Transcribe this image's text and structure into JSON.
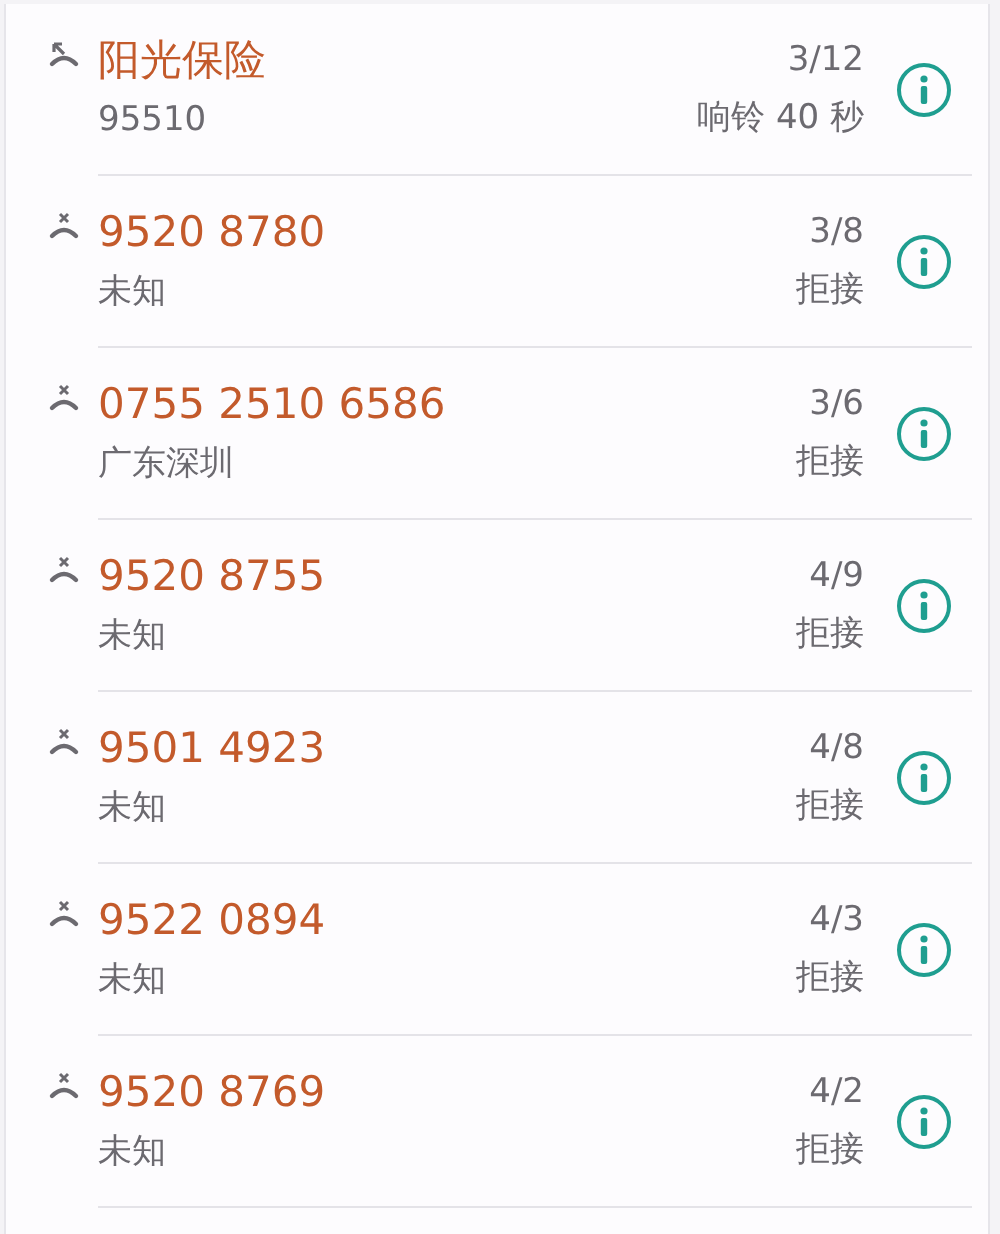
{
  "calls": [
    {
      "kind": "missed",
      "name": "阳光保险",
      "location": "95510",
      "date": "3/12",
      "status": "响铃 40 秒"
    },
    {
      "kind": "rejected",
      "name": "9520 8780",
      "location": "未知",
      "date": "3/8",
      "status": "拒接"
    },
    {
      "kind": "rejected",
      "name": "0755 2510 6586",
      "location": "广东深圳",
      "date": "3/6",
      "status": "拒接"
    },
    {
      "kind": "rejected",
      "name": "9520 8755",
      "location": "未知",
      "date": "4/9",
      "status": "拒接"
    },
    {
      "kind": "rejected",
      "name": "9501 4923",
      "location": "未知",
      "date": "4/8",
      "status": "拒接"
    },
    {
      "kind": "rejected",
      "name": "9522 0894",
      "location": "未知",
      "date": "4/3",
      "status": "拒接"
    },
    {
      "kind": "rejected",
      "name": "9520 8769",
      "location": "未知",
      "date": "4/2",
      "status": "拒接"
    }
  ]
}
